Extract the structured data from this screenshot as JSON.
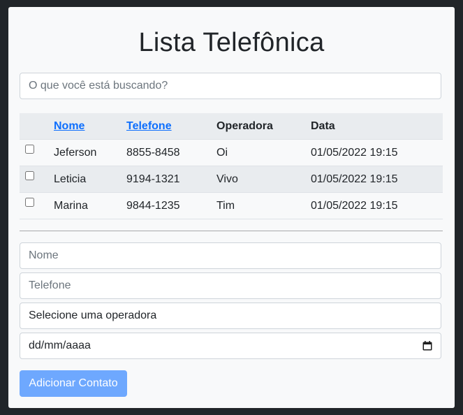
{
  "page": {
    "title": "Lista Telefônica"
  },
  "search": {
    "placeholder": "O que você está buscando?"
  },
  "table": {
    "headers": {
      "nome": "Nome",
      "telefone": "Telefone",
      "operadora": "Operadora",
      "data": "Data"
    },
    "rows": [
      {
        "nome": "Jeferson",
        "telefone": "8855-8458",
        "operadora": "Oi",
        "data": "01/05/2022 19:15",
        "checked": false
      },
      {
        "nome": "Leticia",
        "telefone": "9194-1321",
        "operadora": "Vivo",
        "data": "01/05/2022 19:15",
        "checked": false
      },
      {
        "nome": "Marina",
        "telefone": "9844-1235",
        "operadora": "Tim",
        "data": "01/05/2022 19:15",
        "checked": false
      }
    ]
  },
  "form": {
    "nome_placeholder": "Nome",
    "telefone_placeholder": "Telefone",
    "operadora_value": "Selecione uma operadora",
    "data_value": "dd/mm/aaaa",
    "submit_label": "Adicionar Contato"
  },
  "colors": {
    "background": "#212529",
    "card": "#f8f9fa",
    "link": "#0d6efd",
    "button": "#6ea8fe"
  },
  "icons": {
    "date_picker": "calendar-icon"
  }
}
